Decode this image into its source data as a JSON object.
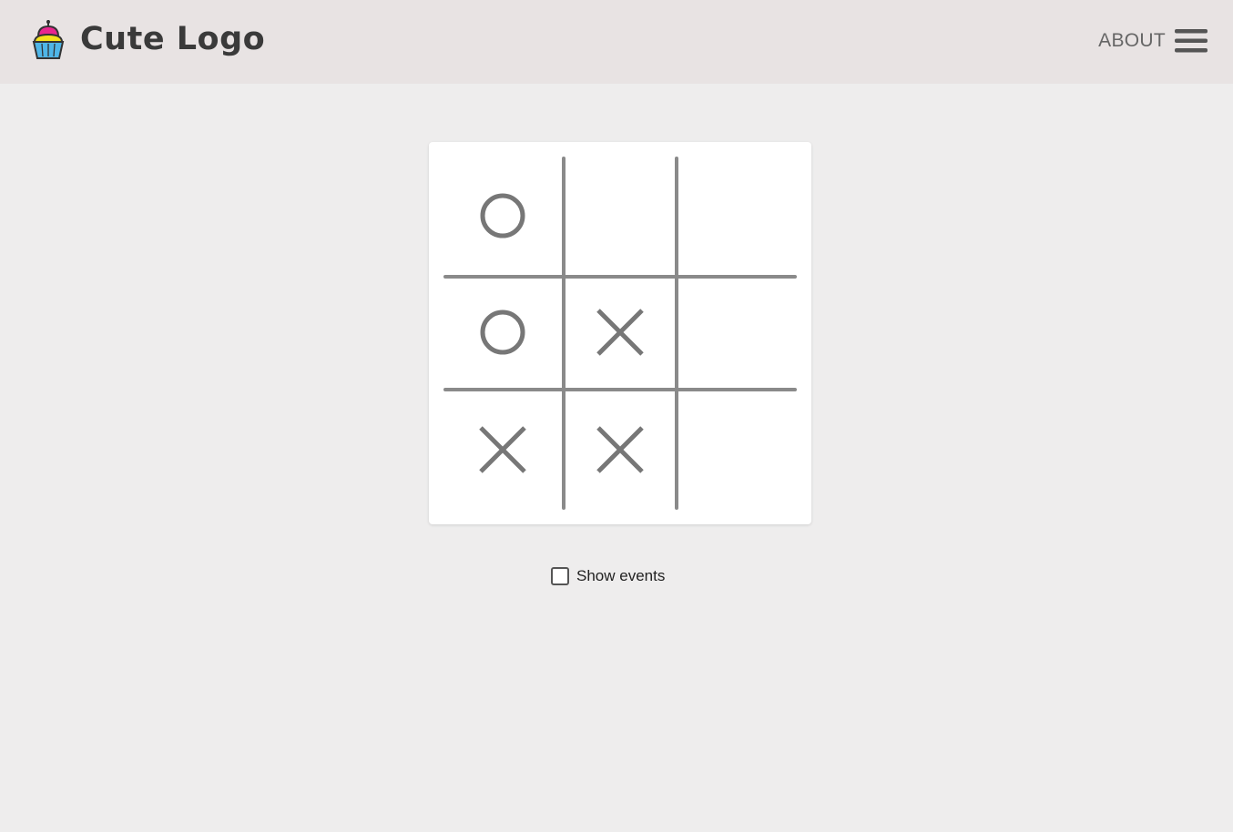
{
  "header": {
    "logo_text": "Cute Logo",
    "logo_icon": "cupcake-icon",
    "nav_label": "ABOUT",
    "menu_icon": "hamburger-menu-icon"
  },
  "board": {
    "cells": [
      {
        "value": "O"
      },
      {
        "value": ""
      },
      {
        "value": ""
      },
      {
        "value": "O"
      },
      {
        "value": "X"
      },
      {
        "value": ""
      },
      {
        "value": "X"
      },
      {
        "value": "X"
      },
      {
        "value": ""
      }
    ]
  },
  "events": {
    "label": "Show events",
    "checked": false
  },
  "colors": {
    "header_bg": "#e8e3e3",
    "page_bg": "#eeeded",
    "mark_color": "#777777",
    "grid_color": "#8a8a8a"
  }
}
